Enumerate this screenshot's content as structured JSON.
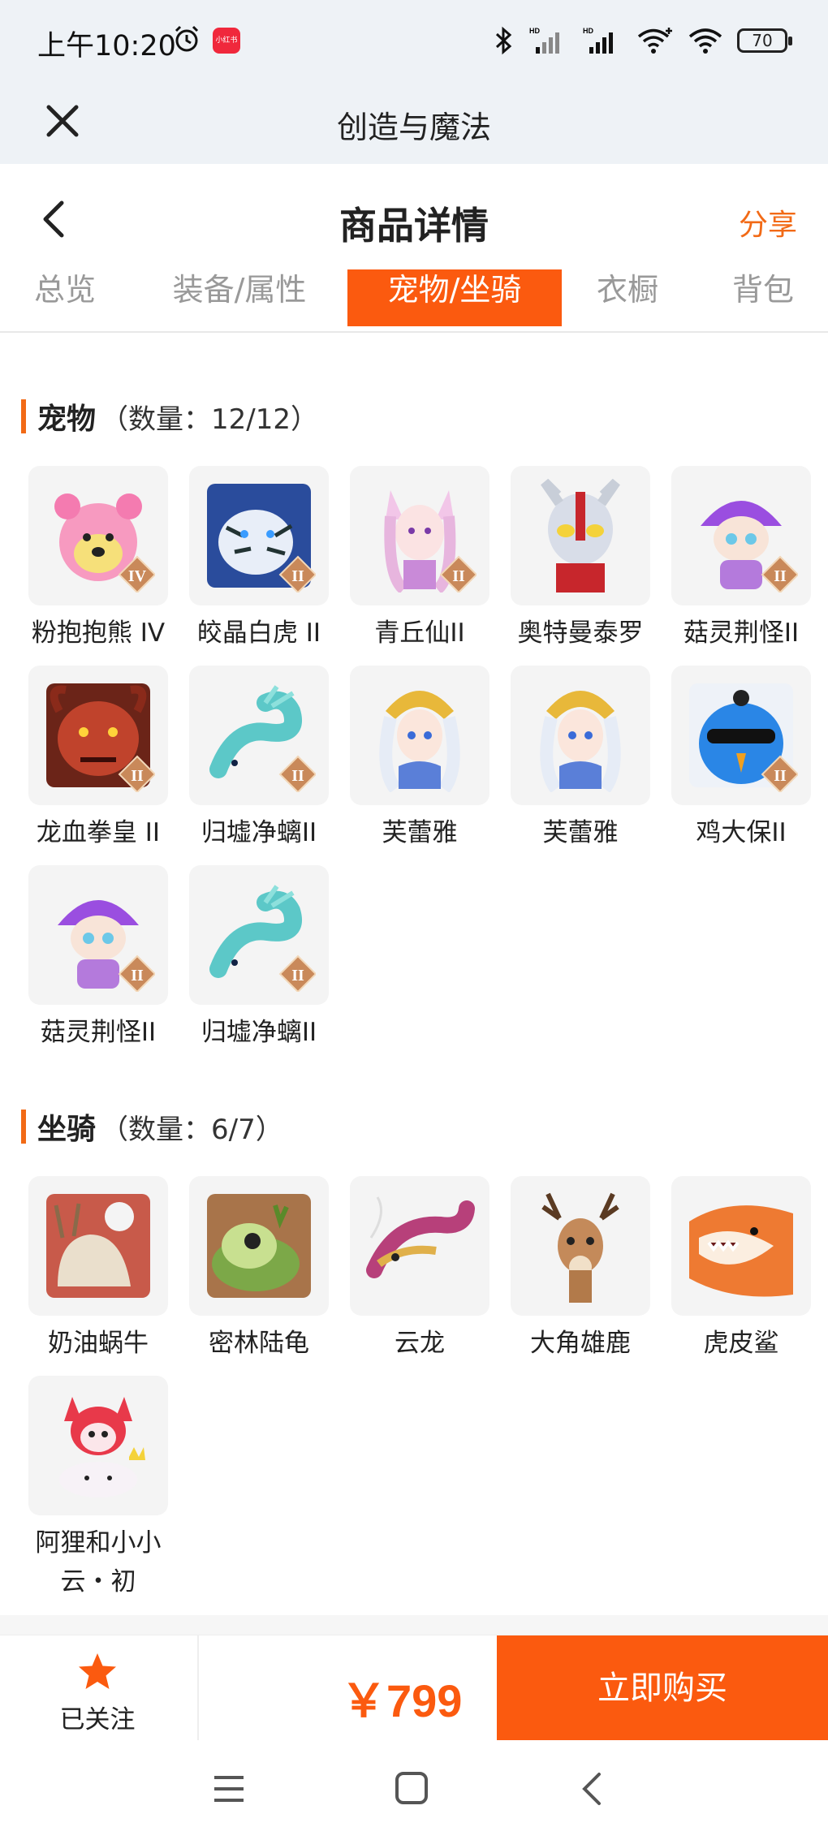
{
  "status_bar": {
    "time": "上午10:20",
    "app_badge": "小红书",
    "battery": "70",
    "network_label": "HD"
  },
  "web_header": {
    "title": "创造与魔法"
  },
  "page_header": {
    "title": "商品详情",
    "share_label": "分享"
  },
  "tabs": [
    {
      "label": "总览",
      "active": false
    },
    {
      "label": "装备/属性",
      "active": false
    },
    {
      "label": "宠物/坐骑",
      "active": true
    },
    {
      "label": "衣橱",
      "active": false
    },
    {
      "label": "背包",
      "active": false
    }
  ],
  "pets": {
    "title": "宠物",
    "count": "（数量：12/12）",
    "items": [
      {
        "name": "粉抱抱熊 IV",
        "icon": "pink-bear-icon",
        "badge": "IV"
      },
      {
        "name": "皎晶白虎 II",
        "icon": "white-tiger-icon",
        "badge": "II"
      },
      {
        "name": "青丘仙II",
        "icon": "fox-fairy-icon",
        "badge": "II"
      },
      {
        "name": "奥特曼泰罗",
        "icon": "ultraman-icon",
        "badge": ""
      },
      {
        "name": "菇灵荆怪II",
        "icon": "purple-mushroom-icon",
        "badge": "II"
      },
      {
        "name": "龙血拳皇 II",
        "icon": "red-beast-icon",
        "badge": "II"
      },
      {
        "name": "归墟净螭II",
        "icon": "cyan-dragon-icon",
        "badge": "II"
      },
      {
        "name": "芙蕾雅",
        "icon": "goddess-icon",
        "badge": ""
      },
      {
        "name": "芙蕾雅",
        "icon": "goddess-icon",
        "badge": ""
      },
      {
        "name": "鸡大保II",
        "icon": "blue-bird-icon",
        "badge": "II"
      },
      {
        "name": "菇灵荆怪II",
        "icon": "purple-mushroom-icon",
        "badge": "II"
      },
      {
        "name": "归墟净螭II",
        "icon": "cyan-dragon-icon",
        "badge": "II"
      }
    ]
  },
  "mounts": {
    "title": "坐骑",
    "count": "（数量：6/7）",
    "items": [
      {
        "name": "奶油蜗牛",
        "icon": "snail-icon"
      },
      {
        "name": "密林陆龟",
        "icon": "turtle-icon"
      },
      {
        "name": "云龙",
        "icon": "cloud-dragon-icon"
      },
      {
        "name": "大角雄鹿",
        "icon": "deer-icon"
      },
      {
        "name": "虎皮鲨",
        "icon": "shark-icon"
      },
      {
        "name": "阿狸和小小\n云・初",
        "icon": "ali-fox-icon"
      }
    ]
  },
  "bottom_bar": {
    "follow_label": "已关注",
    "price": "￥799",
    "buy_label": "立即购买"
  },
  "colors": {
    "accent": "#fb5a0f",
    "badge": "#c9895a"
  }
}
